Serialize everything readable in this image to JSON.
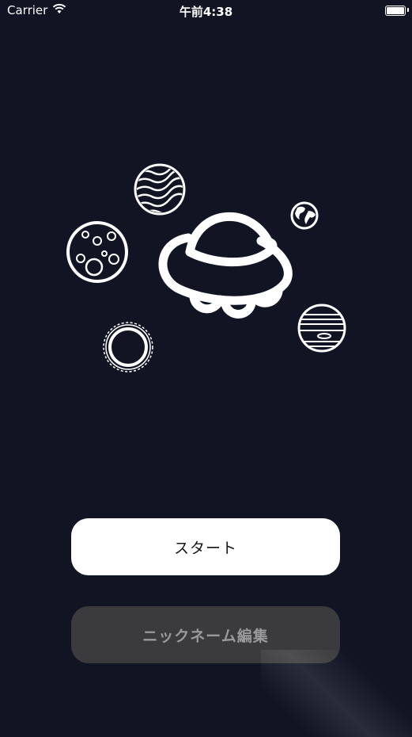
{
  "status_bar": {
    "carrier": "Carrier",
    "time": "午前4:38",
    "icons": [
      "wifi-icon",
      "battery-icon"
    ]
  },
  "illustration": {
    "elements": [
      "ufo-icon",
      "striped-planet-icon",
      "moon-icon",
      "earth-icon",
      "jupiter-icon",
      "sun-icon"
    ],
    "stroke_color": "#ffffff"
  },
  "buttons": {
    "start_label": "スタート",
    "nickname_label": "ニックネーム編集"
  },
  "colors": {
    "background": "#111423",
    "start_button_bg": "#ffffff",
    "nickname_button_bg": "#3b3b3d"
  }
}
